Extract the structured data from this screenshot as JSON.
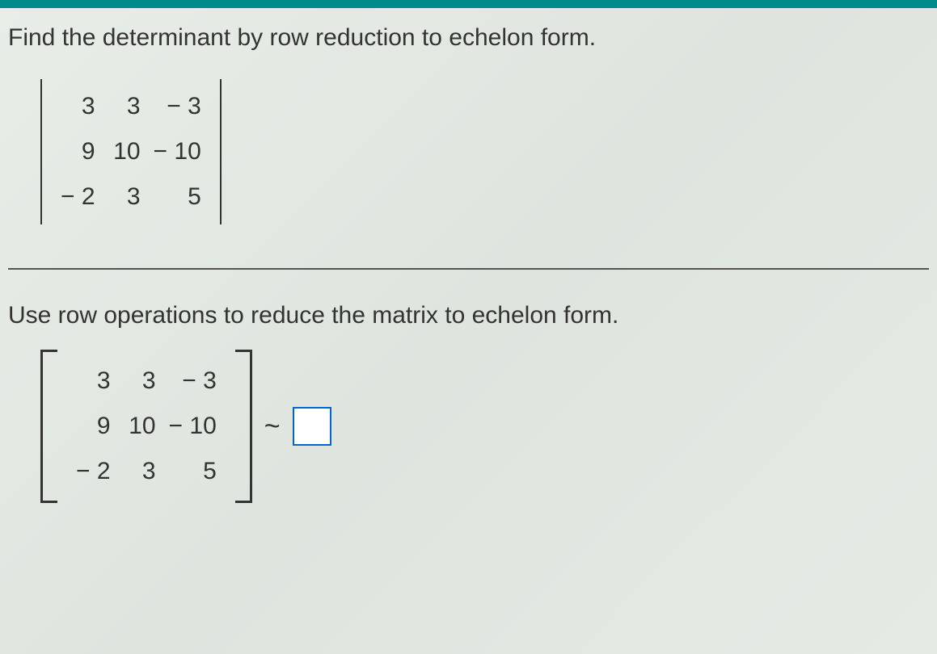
{
  "question": "Find the determinant by row reduction to echelon form.",
  "matrix": {
    "r1": {
      "c1": "3",
      "c2": "3",
      "c3": "− 3"
    },
    "r2": {
      "c1": "9",
      "c2": "10",
      "c3": "− 10"
    },
    "r3": {
      "c1": "− 2",
      "c2": "3",
      "c3": "5"
    }
  },
  "sub_question": "Use row operations to reduce the matrix to echelon form.",
  "tilde": "~"
}
